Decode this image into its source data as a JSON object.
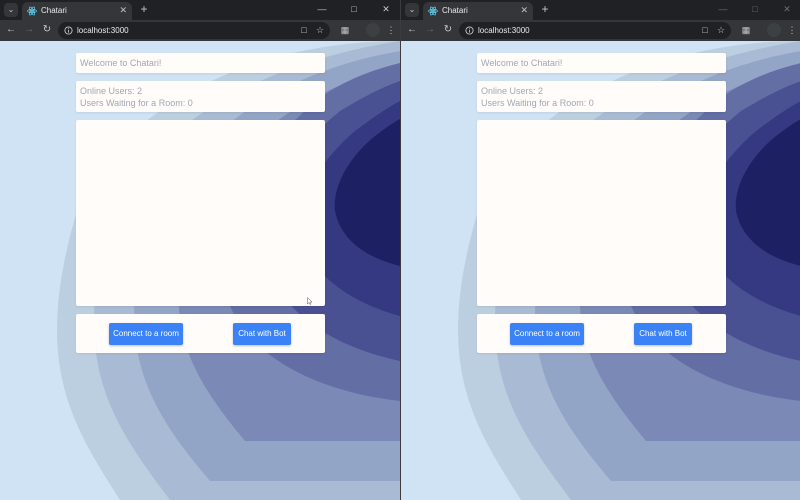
{
  "windows": [
    {
      "tab": {
        "title": "Chatari",
        "favicon": "react-icon"
      },
      "url": "localhost:3000",
      "page": {
        "welcome": "Welcome to Chatari!",
        "online_users": "Online Users: 2",
        "waiting_users": "Users Waiting for a Room: 0",
        "connect_button": "Connect to a room",
        "bot_button": "Chat with Bot"
      }
    },
    {
      "tab": {
        "title": "Chatari",
        "favicon": "react-icon"
      },
      "url": "localhost:3000",
      "page": {
        "welcome": "Welcome to Chatari!",
        "online_users": "Online Users: 2",
        "waiting_users": "Users Waiting for a Room: 0",
        "connect_button": "Connect to a room",
        "bot_button": "Chat with Bot"
      }
    }
  ],
  "colors": {
    "accent_button": "#3b82f6",
    "page_bg": "#cfe3f5",
    "wave_dark": "#1e2064"
  },
  "icons": [
    "tab-search-icon",
    "react-icon",
    "close-icon",
    "new-tab-icon",
    "minimize-icon",
    "maximize-icon",
    "window-close-icon",
    "back-icon",
    "forward-icon",
    "reload-icon",
    "site-info-icon",
    "cast-icon",
    "bookmark-star-icon",
    "extensions-icon",
    "profile-icon",
    "kebab-menu-icon"
  ]
}
